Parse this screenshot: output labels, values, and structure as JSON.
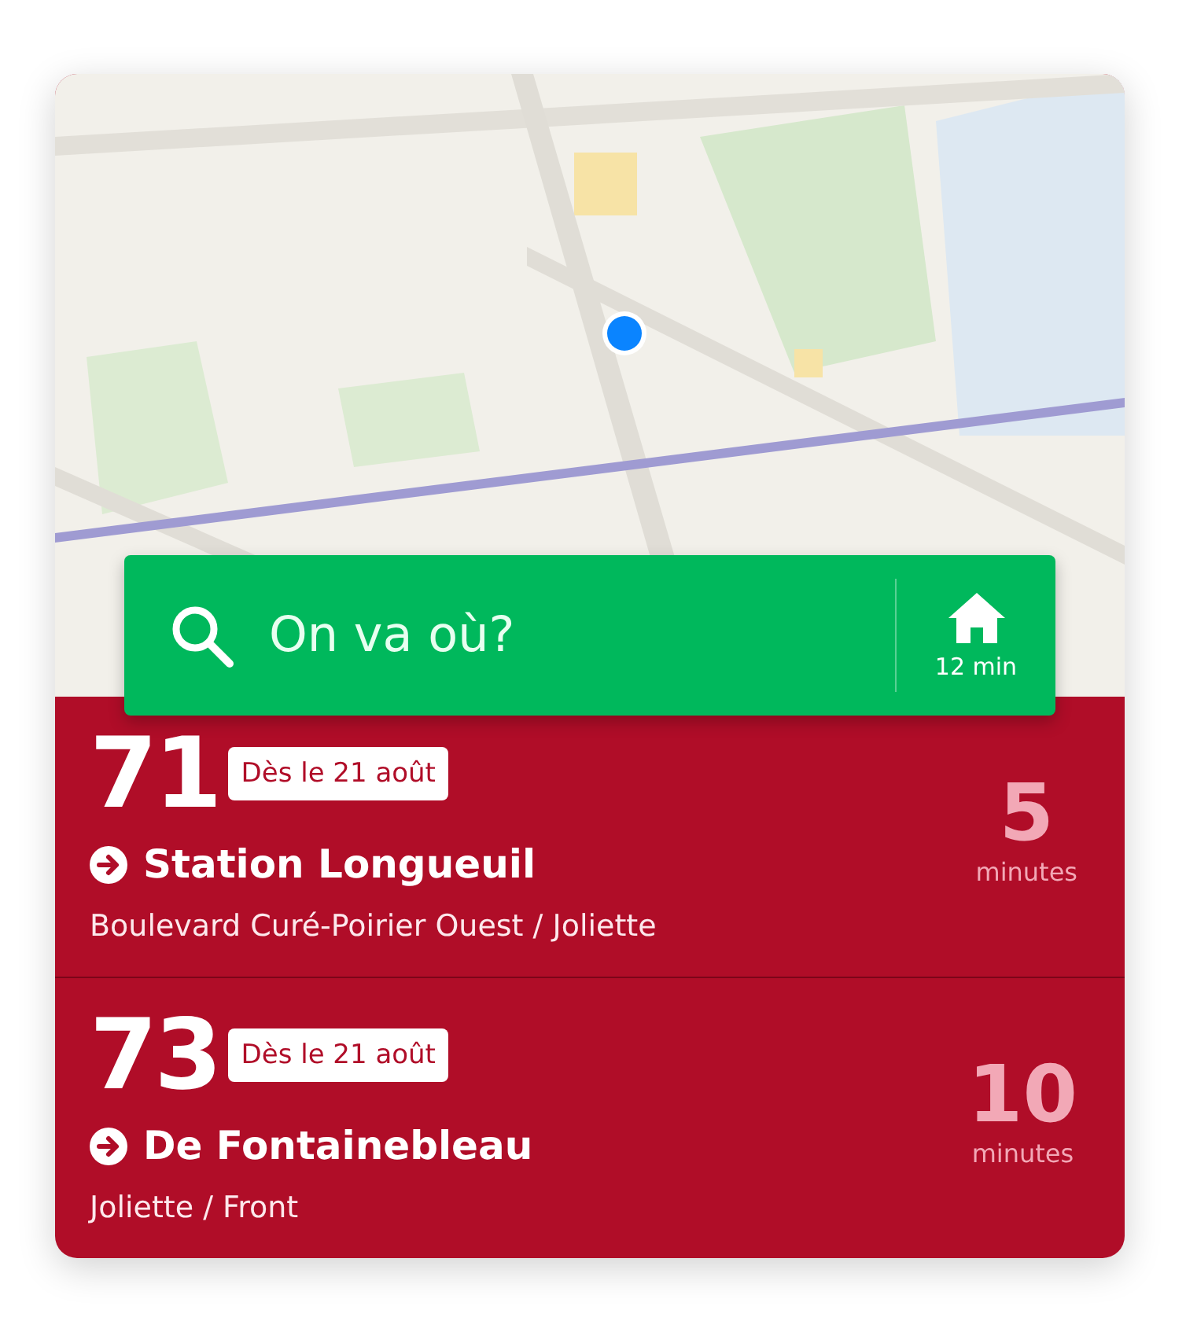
{
  "search": {
    "placeholder": "On va où?"
  },
  "home": {
    "eta": "12 min"
  },
  "departures": [
    {
      "route": "71",
      "badge": "Dès le 21 août",
      "destination": "Station Longueuil",
      "stop": "Boulevard Curé-Poirier Ouest / Joliette",
      "wait": "5",
      "unit": "minutes"
    },
    {
      "route": "73",
      "badge": "Dès le 21 août",
      "destination": "De Fontainebleau",
      "stop": "Joliette / Front",
      "wait": "10",
      "unit": "minutes"
    }
  ]
}
